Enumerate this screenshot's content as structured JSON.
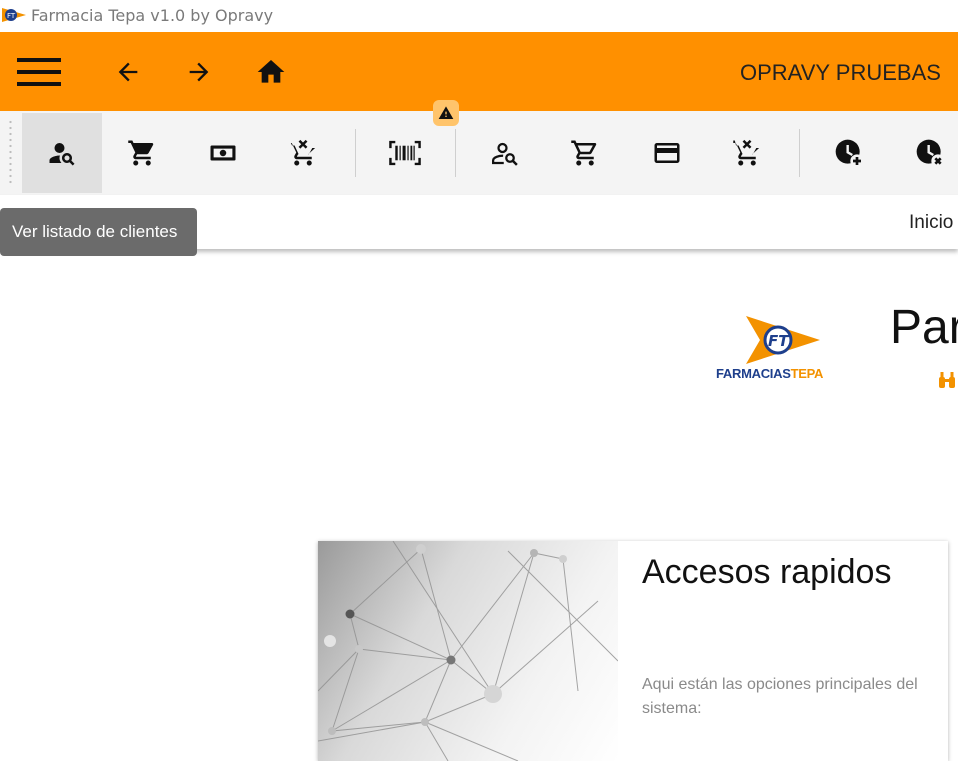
{
  "window": {
    "title": "Farmacia Tepa v1.0 by Opravy"
  },
  "header": {
    "store_name": "OPRAVY PRUEBAS",
    "icons": [
      "menu-icon",
      "arrow-back-icon",
      "arrow-forward-icon",
      "home-icon"
    ]
  },
  "toolbar": {
    "warning_icon": "warning-icon",
    "tooltip": "Ver listado de clientes",
    "buttons": [
      {
        "icon": "user-search-icon",
        "active": true
      },
      {
        "icon": "cart-icon"
      },
      {
        "icon": "cash-icon"
      },
      {
        "icon": "cart-remove-icon"
      },
      {
        "icon": "barcode-scan-icon"
      },
      {
        "icon": "user-search-outline-icon"
      },
      {
        "icon": "cart-outline-icon"
      },
      {
        "icon": "credit-card-icon"
      },
      {
        "icon": "cart-remove-outline-icon"
      },
      {
        "icon": "clock-add-icon"
      },
      {
        "icon": "clock-remove-icon"
      }
    ]
  },
  "breadcrumb": {
    "current": "Inicio"
  },
  "logo": {
    "brand_a": "FARMACIAS",
    "brand_b": "TEPA",
    "monogram": "FT"
  },
  "hero": {
    "title": "Par"
  },
  "card": {
    "title": "Accesos rapidos",
    "description": "Aqui están las opciones principales del sistema:"
  },
  "colors": {
    "accent": "#ff9000",
    "toolbar_bg": "#f4f4f4",
    "tooltip_bg": "#6b6b6b",
    "brand_blue": "#1e3f8c"
  }
}
